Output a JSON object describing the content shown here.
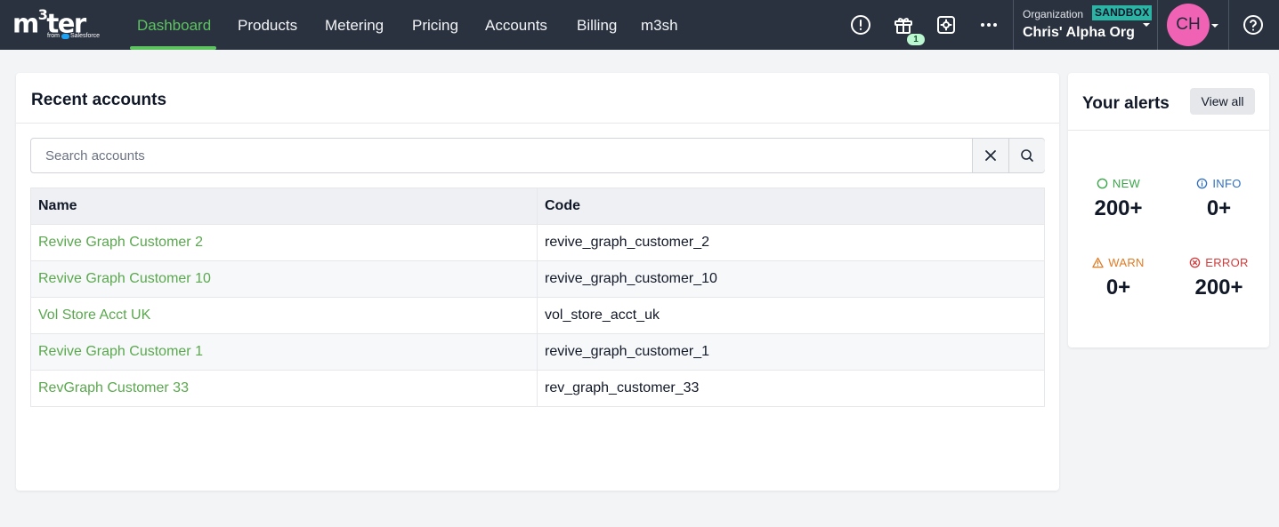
{
  "app": {
    "logo_text": "m3ter",
    "logo_sub_prefix": "from",
    "logo_sub_brand": "Salesforce"
  },
  "nav": {
    "items": [
      {
        "label": "Dashboard",
        "active": true
      },
      {
        "label": "Products",
        "active": false
      },
      {
        "label": "Metering",
        "active": false
      },
      {
        "label": "Pricing",
        "active": false
      },
      {
        "label": "Accounts",
        "active": false
      },
      {
        "label": "Billing",
        "active": false
      },
      {
        "label": "m3sh",
        "active": false
      }
    ],
    "gift_badge": "1"
  },
  "org": {
    "label": "Organization",
    "env_badge": "SANDBOX",
    "name": "Chris' Alpha Org"
  },
  "user": {
    "initials": "CH"
  },
  "colors": {
    "topbar": "#2a3240",
    "accent_green": "#5cc35f",
    "link_green": "#5aa84e",
    "sandbox": "#2bb3a3",
    "avatar": "#f062b4"
  },
  "recent_accounts": {
    "title": "Recent accounts",
    "search_placeholder": "Search accounts",
    "search_value": "",
    "columns": {
      "name": "Name",
      "code": "Code"
    },
    "rows": [
      {
        "name": "Revive Graph Customer 2",
        "code": "revive_graph_customer_2"
      },
      {
        "name": "Revive Graph Customer 10",
        "code": "revive_graph_customer_10"
      },
      {
        "name": "Vol Store Acct UK",
        "code": "vol_store_acct_uk"
      },
      {
        "name": "Revive Graph Customer 1",
        "code": "revive_graph_customer_1"
      },
      {
        "name": "RevGraph Customer 33",
        "code": "rev_graph_customer_33"
      }
    ]
  },
  "alerts": {
    "title": "Your alerts",
    "view_all": "View all",
    "new": {
      "label": "NEW",
      "value": "200+"
    },
    "info": {
      "label": "INFO",
      "value": "0+"
    },
    "warn": {
      "label": "WARN",
      "value": "0+"
    },
    "error": {
      "label": "ERROR",
      "value": "200+"
    }
  },
  "icons": [
    "alert-circle-icon",
    "gift-icon",
    "settings-screen-icon",
    "more-horizontal-icon",
    "chevron-down-icon",
    "help-circle-icon",
    "close-icon",
    "search-icon",
    "circle-icon",
    "info-icon",
    "warning-triangle-icon",
    "x-circle-icon"
  ]
}
